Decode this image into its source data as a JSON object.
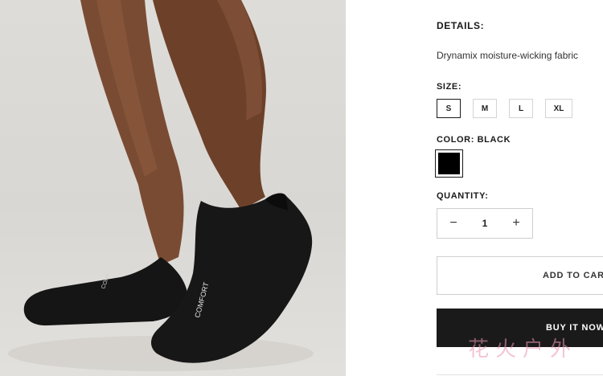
{
  "product_image": {
    "alt_subject": "black no-show sock on foot"
  },
  "details": {
    "heading": "DETAILS:",
    "text": "Drynamix moisture-wicking fabric"
  },
  "size": {
    "label": "SIZE:",
    "options": [
      "S",
      "M",
      "L",
      "XL"
    ],
    "selected": "S"
  },
  "color": {
    "label": "COLOR: BLACK",
    "swatch": "#000000"
  },
  "quantity": {
    "label": "QUANTITY:",
    "value": "1",
    "decrement": "−",
    "increment": "+"
  },
  "actions": {
    "add_to_cart": "ADD TO CART",
    "buy_now": "BUY IT NOW"
  },
  "watermark": "花火户外",
  "colors": {
    "primary": "#1a1a1a",
    "border": "#cfcfcf"
  }
}
